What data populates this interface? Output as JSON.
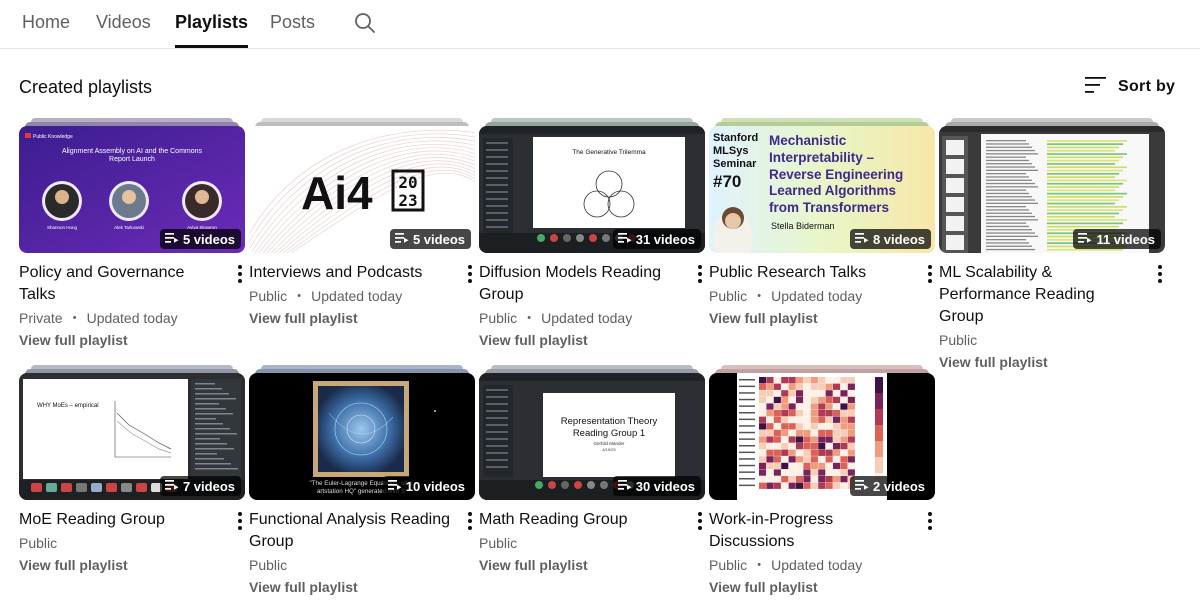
{
  "tabs": [
    {
      "label": "Home"
    },
    {
      "label": "Videos"
    },
    {
      "label": "Playlists"
    },
    {
      "label": "Posts"
    }
  ],
  "active_tab": "Playlists",
  "section": {
    "title": "Created playlists",
    "sort_label": "Sort by"
  },
  "view_label": "View full playlist",
  "playlists": [
    {
      "title": "Policy and Governance Talks",
      "visibility": "Private",
      "updated": "Updated today",
      "count": "5 videos",
      "thumb": "ai-policy",
      "thumb_text": {
        "brand": "Public Knowledge",
        "heading": "Alignment Assembly on AI and the Commons",
        "subheading": "Report Launch",
        "p1": "Shannon Hong",
        "p2": "Alek Tarkowski",
        "p3": "Aviya Skowron"
      }
    },
    {
      "title": "Interviews and Podcasts",
      "visibility": "Public",
      "updated": "Updated today",
      "count": "5 videos",
      "thumb": "ai4",
      "thumb_text": {
        "logo": "Ai4",
        "year_top": "20",
        "year_bottom": "23"
      }
    },
    {
      "title": "Diffusion Models Reading Group",
      "visibility": "Public",
      "updated": "Updated today",
      "count": "31 videos",
      "thumb": "trilemma",
      "thumb_text": {
        "heading": "The Generative Trilemma"
      }
    },
    {
      "title": "Public Research Talks",
      "visibility": "Public",
      "updated": "Updated today",
      "count": "8 videos",
      "thumb": "mlsys",
      "thumb_text": {
        "series1": "Stanford",
        "series2": "MLSys",
        "series3": "Seminar",
        "number": "#70",
        "t1": "Mechanistic",
        "t2": "Interpretability –",
        "t3": "Reverse Engineering",
        "t4": "Learned Algorithms",
        "t5": "from Transformers",
        "speaker": "Stella Biderman"
      }
    },
    {
      "title": "ML Scalability & Performance Reading Group",
      "visibility": "Public",
      "updated": "",
      "count": "11 videos",
      "thumb": "paper",
      "thumb_text": {}
    },
    {
      "title": "MoE Reading Group",
      "visibility": "Public",
      "updated": "",
      "count": "7 videos",
      "thumb": "moe",
      "thumb_text": {
        "heading": "WHY MoEs – empirical"
      }
    },
    {
      "title": "Functional Analysis Reading Group",
      "visibility": "Public",
      "updated": "",
      "count": "10 videos",
      "thumb": "euler",
      "thumb_text": {
        "caption1": "\"The Euler-Lagrange Equations, oil p",
        "caption2": "artstation HQ\" generated with S"
      }
    },
    {
      "title": "Math Reading Group",
      "visibility": "Public",
      "updated": "",
      "count": "30 videos",
      "thumb": "reptheory",
      "thumb_text": {
        "heading1": "Representation Theory",
        "heading2": "Reading Group 1",
        "presenter": "Gerhild Mander",
        "date": "4/19/23"
      }
    },
    {
      "title": "Work-in-Progress Discussions",
      "visibility": "Public",
      "updated": "Updated today",
      "count": "2 videos",
      "thumb": "heatmap",
      "thumb_text": {}
    }
  ],
  "colors": {
    "text": "#0f0f0f",
    "secondary": "#606060",
    "divider": "#e5e5e5",
    "badge_bg": "rgba(0,0,0,0.72)"
  },
  "icons": {
    "search": "search-icon",
    "sort": "sort-icon",
    "playlist": "playlist-icon",
    "more": "more-vert-icon"
  }
}
